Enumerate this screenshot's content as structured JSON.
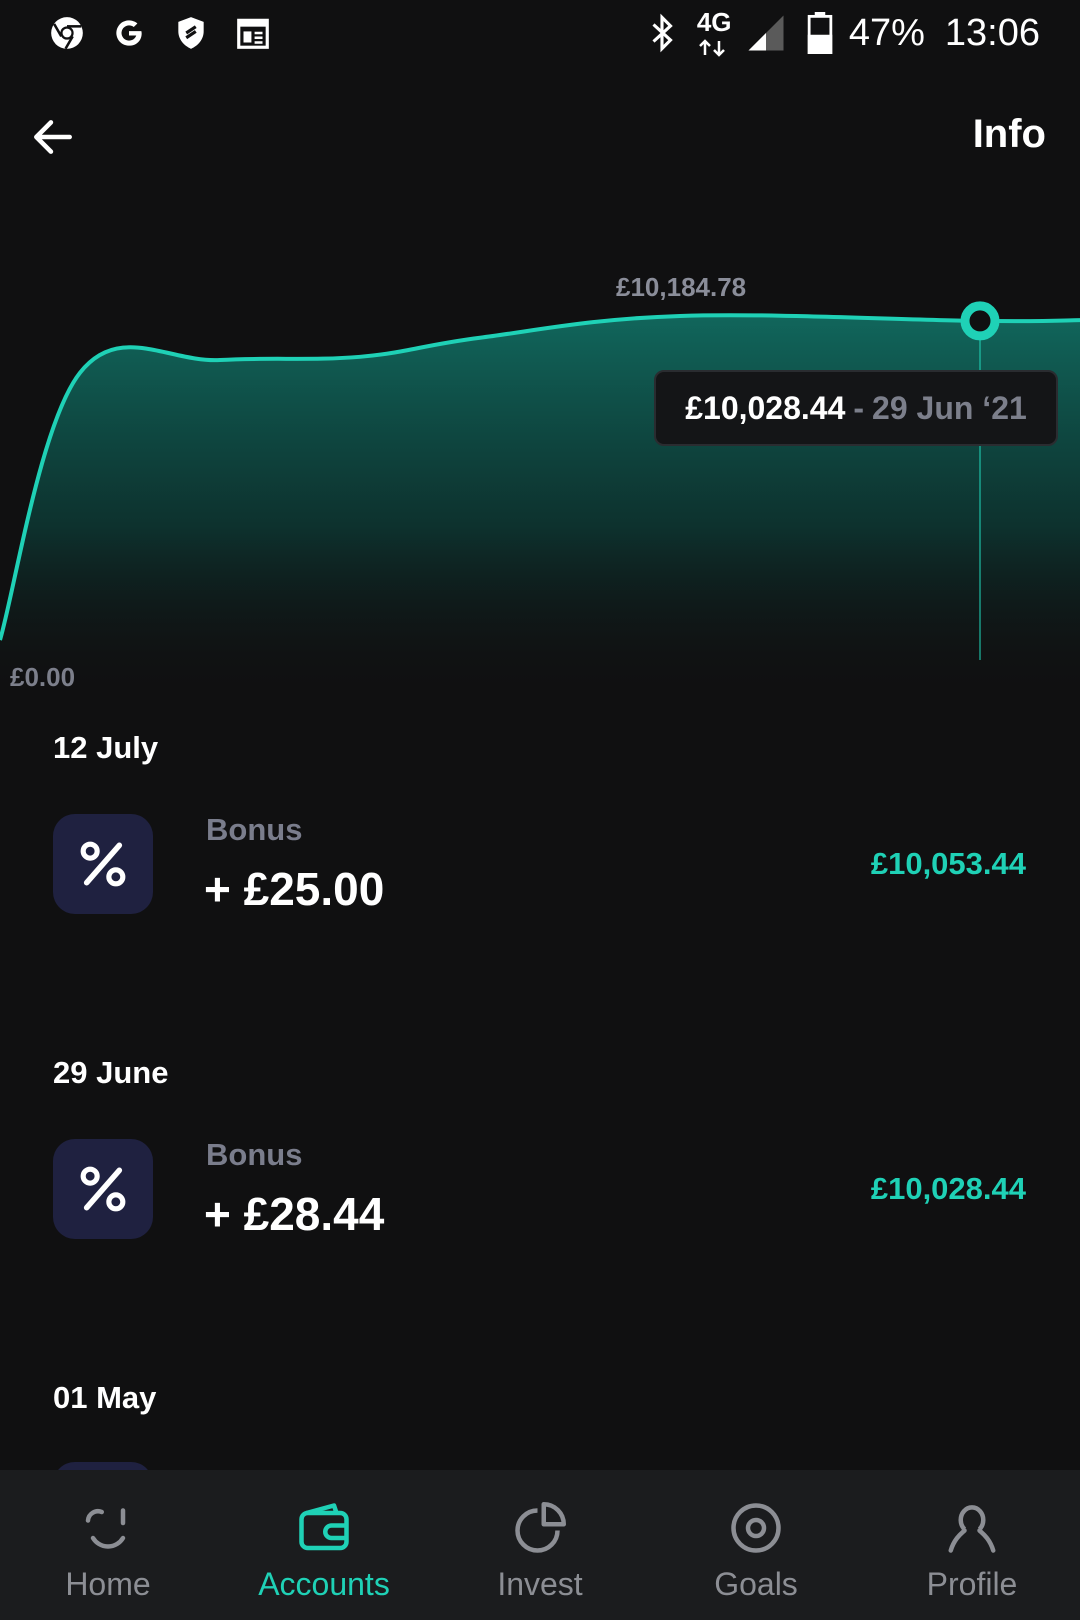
{
  "status_bar": {
    "left_icons": [
      "chrome-icon",
      "google-icon",
      "shield-icon",
      "calendar-icon"
    ],
    "network": "4G",
    "battery_percent": "47%",
    "time": "13:06"
  },
  "header": {
    "back_icon": "arrow-left-icon",
    "info_label": "Info"
  },
  "chart_data": {
    "type": "area",
    "peak_label": "£10,184.78",
    "min_label": "£0.00",
    "tooltip_value": "£10,028.44",
    "tooltip_separator": "-",
    "tooltip_date": "29 Jun ‘21",
    "line_color": "#1fd1b6",
    "fill_color": "#0f5f55",
    "ylim": [
      0,
      11000
    ],
    "selected_index": 6,
    "series": [
      {
        "values": [
          0,
          8400,
          8800,
          8900,
          9500,
          10184.78,
          10028.44,
          10053.44
        ]
      }
    ]
  },
  "transactions": [
    {
      "date": "12 July",
      "type": "Bonus",
      "amount": "+ £25.00",
      "balance": "£10,053.44",
      "icon": "percent-icon"
    },
    {
      "date": "29 June",
      "type": "Bonus",
      "amount": "+ £28.44",
      "balance": "£10,028.44",
      "icon": "percent-icon"
    },
    {
      "date": "01 May"
    }
  ],
  "nav": {
    "items": [
      {
        "label": "Home",
        "icon": "home-smile-icon",
        "active": false
      },
      {
        "label": "Accounts",
        "icon": "wallet-icon",
        "active": true
      },
      {
        "label": "Invest",
        "icon": "pie-chart-icon",
        "active": false
      },
      {
        "label": "Goals",
        "icon": "target-icon",
        "active": false
      },
      {
        "label": "Profile",
        "icon": "user-icon",
        "active": false
      }
    ]
  },
  "colors": {
    "background": "#101011",
    "accent": "#1fd1b6",
    "icon_tile": "#1f2140",
    "muted_text": "#7c7f8b",
    "nav_background": "#1b1c1e"
  }
}
